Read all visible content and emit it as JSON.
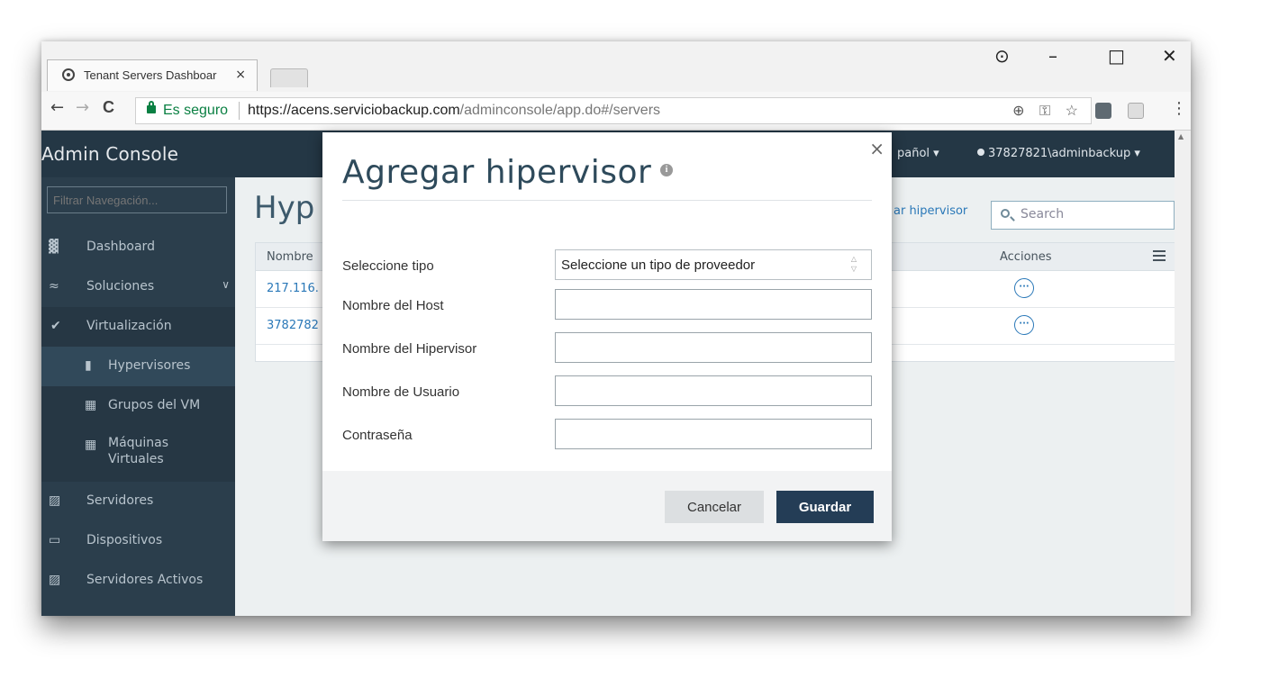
{
  "browser": {
    "tab_title": "Tenant Servers Dashboar",
    "tab_close": "×",
    "window_controls": {
      "account": "⊙",
      "minimize": "–",
      "maximize": "□",
      "close": "✕"
    },
    "nav": {
      "back": "←",
      "forward": "→",
      "reload": "C"
    },
    "secure_label": "Es seguro",
    "url_host": "https://acens.serviciobackup.com",
    "url_path": "/adminconsole/app.do#/servers",
    "omni_icons": "⊕ ⚿ ☆",
    "menu_dots": "⋮"
  },
  "app": {
    "brand": "Admin Console",
    "language": "pañol ▾",
    "user": "37827821\\adminbackup ▾"
  },
  "sidebar": {
    "filter_placeholder": "Filtrar Navegación...",
    "items": [
      {
        "label": "Dashboard",
        "icon": "dashboard-icon",
        "glyph": "▓"
      },
      {
        "label": "Soluciones",
        "icon": "layers-icon",
        "glyph": "≈",
        "chevron": "∨"
      },
      {
        "label": "Virtualización",
        "icon": "chevron-down-icon",
        "glyph": "✔"
      },
      {
        "label": "Hypervisores",
        "icon": "server-icon",
        "glyph": "▮"
      },
      {
        "label": "Grupos del VM",
        "icon": "vm-group-icon",
        "glyph": "▦"
      },
      {
        "label": "Máquinas Virtuales",
        "icon": "vm-icon",
        "glyph": "▦"
      },
      {
        "label": "Servidores",
        "icon": "servers-icon",
        "glyph": "▨"
      },
      {
        "label": "Dispositivos",
        "icon": "laptop-icon",
        "glyph": "▭"
      },
      {
        "label": "Servidores Activos",
        "icon": "active-servers-icon",
        "glyph": "▨"
      }
    ]
  },
  "main": {
    "title": "Hyp",
    "add_link": "ar hipervisor",
    "search_placeholder": "Search",
    "columns": {
      "name": "Nombre",
      "actions": "Acciones"
    },
    "rows": [
      {
        "name": "217.116.",
        "action_glyph": "···"
      },
      {
        "name": "3782782",
        "action_glyph": "···"
      }
    ]
  },
  "modal": {
    "title": "Agregar hipervisor",
    "info": "i",
    "close": "×",
    "fields": [
      {
        "label": "Seleccione tipo",
        "value": "Seleccione un tipo de proveedor"
      },
      {
        "label": "Nombre del Host",
        "value": ""
      },
      {
        "label": "Nombre del Hipervisor",
        "value": ""
      },
      {
        "label": "Nombre de Usuario",
        "value": ""
      },
      {
        "label": "Contraseña",
        "value": ""
      }
    ],
    "cancel": "Cancelar",
    "save": "Guardar"
  }
}
